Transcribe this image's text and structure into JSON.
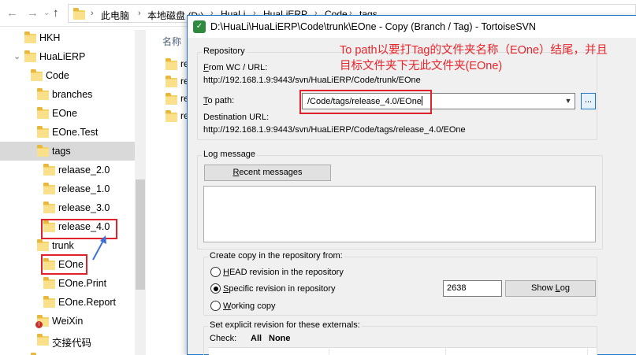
{
  "explorer": {
    "breadcrumb": [
      "此电脑",
      "本地磁盘 (D:)",
      "HuaLi",
      "HuaLiERP",
      "Code",
      "tags"
    ],
    "column_name": "名称",
    "tree": [
      {
        "label": "HKH",
        "icon": "folder-icon"
      },
      {
        "label": "HuaLiERP",
        "icon": "folder-lock-icon"
      },
      {
        "label": "Code",
        "icon": "folder-icon"
      },
      {
        "label": "branches",
        "icon": "folder-icon"
      },
      {
        "label": "EOne",
        "icon": "folder-icon"
      },
      {
        "label": "EOne.Test",
        "icon": "folder-icon"
      },
      {
        "label": "tags",
        "icon": "folder-icon",
        "selected": true
      },
      {
        "label": "relaase_2.0",
        "icon": "folder-icon"
      },
      {
        "label": "release_1.0",
        "icon": "folder-icon"
      },
      {
        "label": "release_3.0",
        "icon": "folder-icon"
      },
      {
        "label": "release_4.0",
        "icon": "folder-icon",
        "highlighted": true
      },
      {
        "label": "trunk",
        "icon": "folder-icon"
      },
      {
        "label": "EOne",
        "icon": "folder-icon",
        "highlighted": true
      },
      {
        "label": "EOne.Print",
        "icon": "folder-icon"
      },
      {
        "label": "EOne.Report",
        "icon": "folder-icon"
      },
      {
        "label": "WeiXin",
        "icon": "folder-error-icon"
      },
      {
        "label": "交接代码",
        "icon": "folder-icon"
      }
    ],
    "files": [
      "re",
      "re",
      "re",
      "re"
    ]
  },
  "dialog": {
    "title": "D:\\HuaLi\\HuaLiERP\\Code\\trunk\\EOne - Copy (Branch / Tag) - TortoiseSVN",
    "repository": {
      "group_title": "Repository",
      "from_label": "From WC / URL:",
      "from_url": "http://192.168.1.9:9443/svn/HuaLiERP/Code/trunk/EOne",
      "to_label": "To path:",
      "to_path": "/Code/tags/release_4.0/EOne",
      "browse_label": "...",
      "dest_label": "Destination URL:",
      "dest_url": "http://192.168.1.9:9443/svn/HuaLiERP/Code/tags/release_4.0/EOne"
    },
    "log": {
      "group_title": "Log message",
      "recent_button": "Recent messages"
    },
    "copy_from": {
      "group_title": "Create copy in the repository from:",
      "head_option": "HEAD revision in the repository",
      "specific_option": "Specific revision in repository",
      "working_option": "Working copy",
      "revision": "2638",
      "show_log_button": "Show Log",
      "selected": "specific"
    },
    "externals": {
      "group_title": "Set explicit revision for these externals:",
      "check_label": "Check:",
      "all_label": "All",
      "none_label": "None"
    }
  },
  "annotation": {
    "text_line1": "To path以要打Tag的文件夹名称（EOne）结尾，并且",
    "text_line2": "目标文件夹下无此文件夹(EOne)",
    "color": "#e8262d"
  }
}
